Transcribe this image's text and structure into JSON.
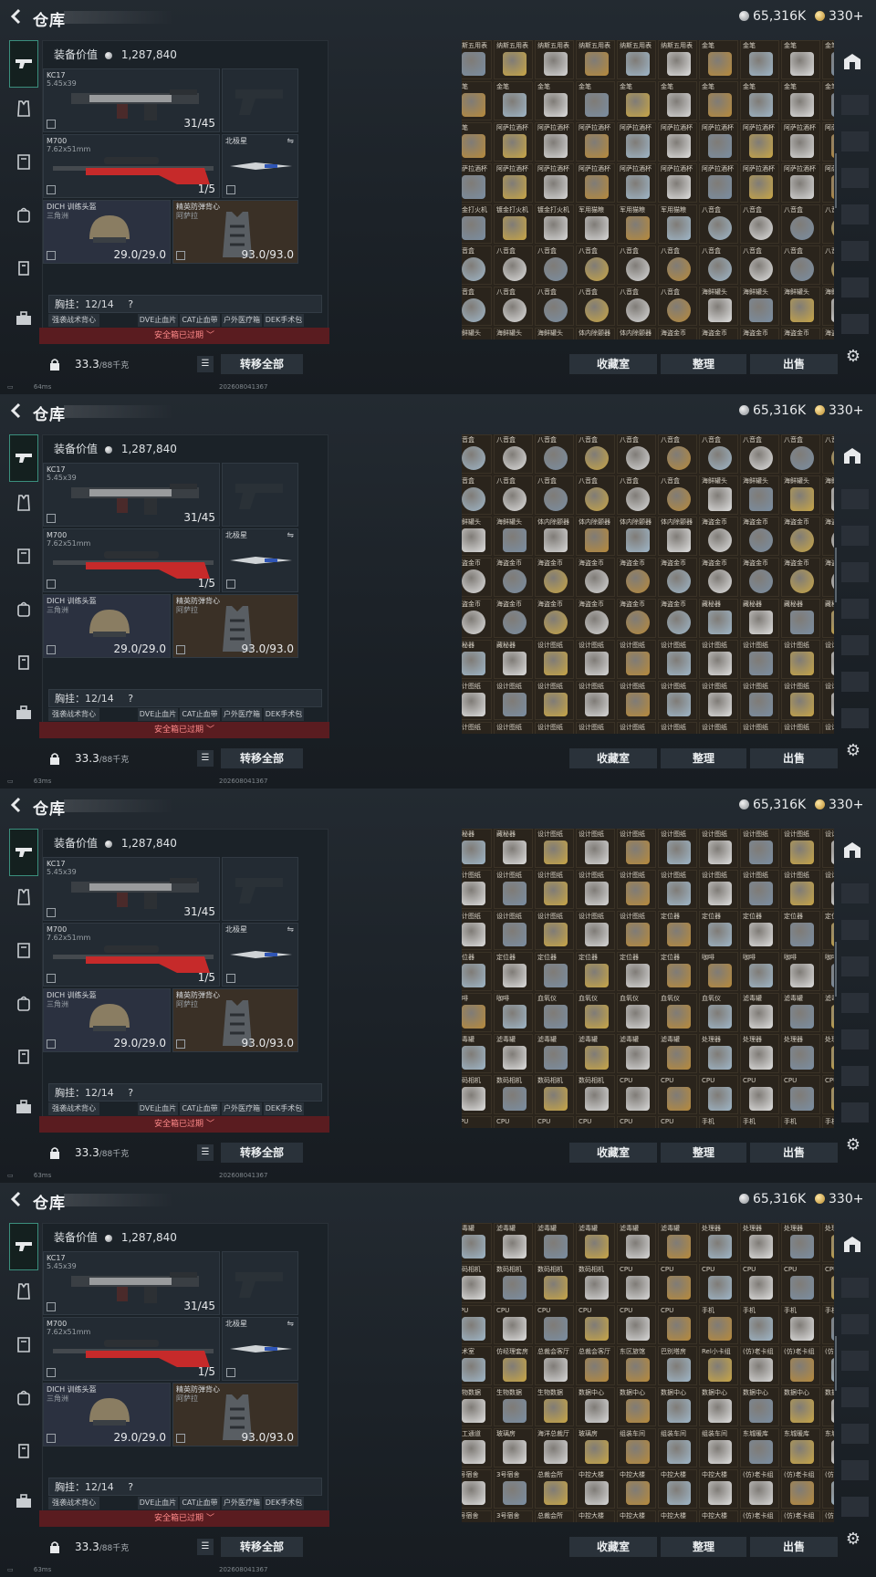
{
  "header": {
    "title": "仓库",
    "silver": "65,316K",
    "gold": "330+"
  },
  "loadout": {
    "value_label": "装备价值",
    "value": "1,287,840",
    "primary": {
      "name": "KC17",
      "ammo": "5.45x39",
      "count": "31/45"
    },
    "secondary": {
      "name": "M700",
      "ammo": "7.62x51mm",
      "count": "1/5"
    },
    "melee": {
      "name": "北极星"
    },
    "helmet": {
      "name": "DICH 训练头盔",
      "sub": "三角洲",
      "durability": "29.0/29.0"
    },
    "armor": {
      "name": "精英防弹背心",
      "sub": "阿萨拉",
      "durability": "93.0/93.0"
    },
    "chest_label": "胸挂：12/14",
    "help": "?",
    "pouches": [
      "强袭战术背心",
      "DVE止血片",
      "CAT止血带",
      "户外医疗箱",
      "DEK手术包"
    ],
    "warning": "安全箱已过期",
    "weight": "33.3",
    "weight_unit": "/88千克",
    "transfer_label": "转移全部"
  },
  "actions": {
    "collection": "收藏室",
    "sort": "整理",
    "sell": "出售"
  },
  "footer": {
    "ping": [
      "64ms",
      "63ms",
      "63ms",
      "63ms"
    ],
    "id": "202608041367"
  },
  "panels": [
    {
      "rows": [
        [
          "纳斯五用表",
          "纳斯五用表",
          "纳斯五用表",
          "纳斯五用表",
          "纳斯五用表",
          "纳斯五用表",
          "金笔",
          "金笔",
          "金笔",
          "金笔"
        ],
        [
          "金笔",
          "金笔",
          "金笔",
          "金笔",
          "金笔",
          "金笔",
          "金笔",
          "金笔",
          "金笔",
          "金笔"
        ],
        [
          "金笔",
          "阿萨拉酒杯",
          "阿萨拉酒杯",
          "阿萨拉酒杯",
          "阿萨拉酒杯",
          "阿萨拉酒杯",
          "阿萨拉酒杯",
          "阿萨拉酒杯",
          "阿萨拉酒杯",
          "阿萨拉酒杯"
        ],
        [
          "阿萨拉酒杯",
          "阿萨拉酒杯",
          "阿萨拉酒杯",
          "阿萨拉酒杯",
          "阿萨拉酒杯",
          "阿萨拉酒杯",
          "阿萨拉酒杯",
          "阿萨拉酒杯",
          "阿萨拉酒杯",
          "阿萨拉酒杯"
        ],
        [
          "镀金打火机",
          "镀金打火机",
          "镀金打火机",
          "军用猫粮",
          "军用猫粮",
          "军用猫粮",
          "八音盒",
          "八音盒",
          "八音盒",
          "八音盒"
        ],
        [
          "八音盒",
          "八音盒",
          "八音盒",
          "八音盒",
          "八音盒",
          "八音盒",
          "八音盒",
          "八音盒",
          "八音盒",
          "八音盒"
        ],
        [
          "八音盒",
          "八音盒",
          "八音盒",
          "八音盒",
          "八音盒",
          "八音盒",
          "海鲜罐头",
          "海鲜罐头",
          "海鲜罐头",
          "海鲜罐头"
        ],
        [
          "海鲜罐头",
          "海鲜罐头",
          "海鲜罐头",
          "体内除颤器",
          "体内除颤器",
          "海盗金币",
          "海盗金币",
          "海盗金币",
          "海盗金币",
          "海盗金币"
        ]
      ]
    },
    {
      "rows": [
        [
          "八音盒",
          "八音盒",
          "八音盒",
          "八音盒",
          "八音盒",
          "八音盒",
          "八音盒",
          "八音盒",
          "八音盒",
          "八音盒"
        ],
        [
          "八音盒",
          "八音盒",
          "八音盒",
          "八音盒",
          "八音盒",
          "八音盒",
          "海鲜罐头",
          "海鲜罐头",
          "海鲜罐头",
          "海鲜罐头"
        ],
        [
          "海鲜罐头",
          "海鲜罐头",
          "体内除颤器",
          "体内除颤器",
          "体内除颤器",
          "体内除颤器",
          "海盗金币",
          "海盗金币",
          "海盗金币",
          "海盗金币"
        ],
        [
          "海盗金币",
          "海盗金币",
          "海盗金币",
          "海盗金币",
          "海盗金币",
          "海盗金币",
          "海盗金币",
          "海盗金币",
          "海盗金币",
          "海盗金币"
        ],
        [
          "海盗金币",
          "海盗金币",
          "海盗金币",
          "海盗金币",
          "海盗金币",
          "海盗金币",
          "藏秘器",
          "藏秘器",
          "藏秘器",
          "藏秘器"
        ],
        [
          "藏秘器",
          "藏秘器",
          "设计图纸",
          "设计图纸",
          "设计图纸",
          "设计图纸",
          "设计图纸",
          "设计图纸",
          "设计图纸",
          "设计图纸"
        ],
        [
          "设计图纸",
          "设计图纸",
          "设计图纸",
          "设计图纸",
          "设计图纸",
          "设计图纸",
          "设计图纸",
          "设计图纸",
          "设计图纸",
          "设计图纸"
        ],
        [
          "设计图纸",
          "设计图纸",
          "设计图纸",
          "设计图纸",
          "设计图纸",
          "设计图纸",
          "设计图纸",
          "设计图纸",
          "设计图纸",
          "设计图纸"
        ]
      ]
    },
    {
      "rows": [
        [
          "藏秘器",
          "藏秘器",
          "设计图纸",
          "设计图纸",
          "设计图纸",
          "设计图纸",
          "设计图纸",
          "设计图纸",
          "设计图纸",
          "设计图纸"
        ],
        [
          "设计图纸",
          "设计图纸",
          "设计图纸",
          "设计图纸",
          "设计图纸",
          "设计图纸",
          "设计图纸",
          "设计图纸",
          "设计图纸",
          "设计图纸"
        ],
        [
          "设计图纸",
          "设计图纸",
          "设计图纸",
          "设计图纸",
          "设计图纸",
          "定位器",
          "定位器",
          "定位器",
          "定位器",
          "定位器"
        ],
        [
          "定位器",
          "定位器",
          "定位器",
          "定位器",
          "定位器",
          "定位器",
          "咖啡",
          "咖啡",
          "咖啡",
          "咖啡"
        ],
        [
          "咖啡",
          "咖啡",
          "血氧仪",
          "血氧仪",
          "血氧仪",
          "血氧仪",
          "血氧仪",
          "滤毒罐",
          "滤毒罐",
          "滤毒罐"
        ],
        [
          "滤毒罐",
          "滤毒罐",
          "滤毒罐",
          "滤毒罐",
          "滤毒罐",
          "滤毒罐",
          "处理器",
          "处理器",
          "处理器",
          "处理器"
        ],
        [
          "数码相机",
          "数码相机",
          "数码相机",
          "数码相机",
          "CPU",
          "CPU",
          "CPU",
          "CPU",
          "CPU",
          "CPU"
        ],
        [
          "CPU",
          "CPU",
          "CPU",
          "CPU",
          "CPU",
          "CPU",
          "手机",
          "手机",
          "手机",
          "手机"
        ]
      ]
    },
    {
      "rows": [
        [
          "滤毒罐",
          "滤毒罐",
          "滤毒罐",
          "滤毒罐",
          "滤毒罐",
          "滤毒罐",
          "处理器",
          "处理器",
          "处理器",
          "处理器"
        ],
        [
          "数码相机",
          "数码相机",
          "数码相机",
          "数码相机",
          "CPU",
          "CPU",
          "CPU",
          "CPU",
          "CPU",
          "CPU"
        ],
        [
          "CPU",
          "CPU",
          "CPU",
          "CPU",
          "CPU",
          "CPU",
          "手机",
          "手机",
          "手机",
          "手机"
        ],
        [
          "技术室",
          "仿经理套房",
          "总裁会客厅",
          "总裁会客厅",
          "东区旅馆",
          "巴别塔房",
          "Rel小卡组",
          "(仿)老卡组",
          "(仿)老卡组",
          "(仿)老卡组"
        ],
        [
          "生物数据",
          "生物数据",
          "生物数据",
          "数据中心",
          "数据中心",
          "数据中心",
          "数据中心",
          "数据中心",
          "数据中心",
          "数据中心"
        ],
        [
          "员工通道",
          "玻璃房",
          "海洋总裁厅",
          "玻璃房",
          "组装车间",
          "组装车间",
          "组装车间",
          "东城暖库",
          "东城暖库",
          "东城暖库"
        ],
        [
          "3号宿舍",
          "3号宿舍",
          "总裁会所",
          "中控大楼",
          "中控大楼",
          "中控大楼",
          "中控大楼",
          "(仿)老卡组",
          "(仿)老卡组",
          "(仿)老卡组"
        ],
        [
          "3号宿舍",
          "3号宿舍",
          "总裁会所",
          "中控大楼",
          "中控大楼",
          "中控大楼",
          "中控大楼",
          "(仿)老卡组",
          "(仿)老卡组",
          "(仿)老卡组"
        ]
      ]
    }
  ],
  "colors": {
    "accent": "#3b8f7d",
    "warning_bg": "#5a1c20",
    "warning_text": "#ff8a8a",
    "grid_bg": "#2a241c",
    "rifle_red": "#c62a2a"
  },
  "icons": [
    "back-arrow-icon",
    "silver-coin-icon",
    "gold-coin-icon",
    "pistol-icon",
    "vest-icon",
    "armor-icon",
    "backpack-icon",
    "pouch-icon",
    "toolbox-icon",
    "lock-icon",
    "list-icon",
    "helmet-icon",
    "gear-icon",
    "arrow-down-icon"
  ]
}
